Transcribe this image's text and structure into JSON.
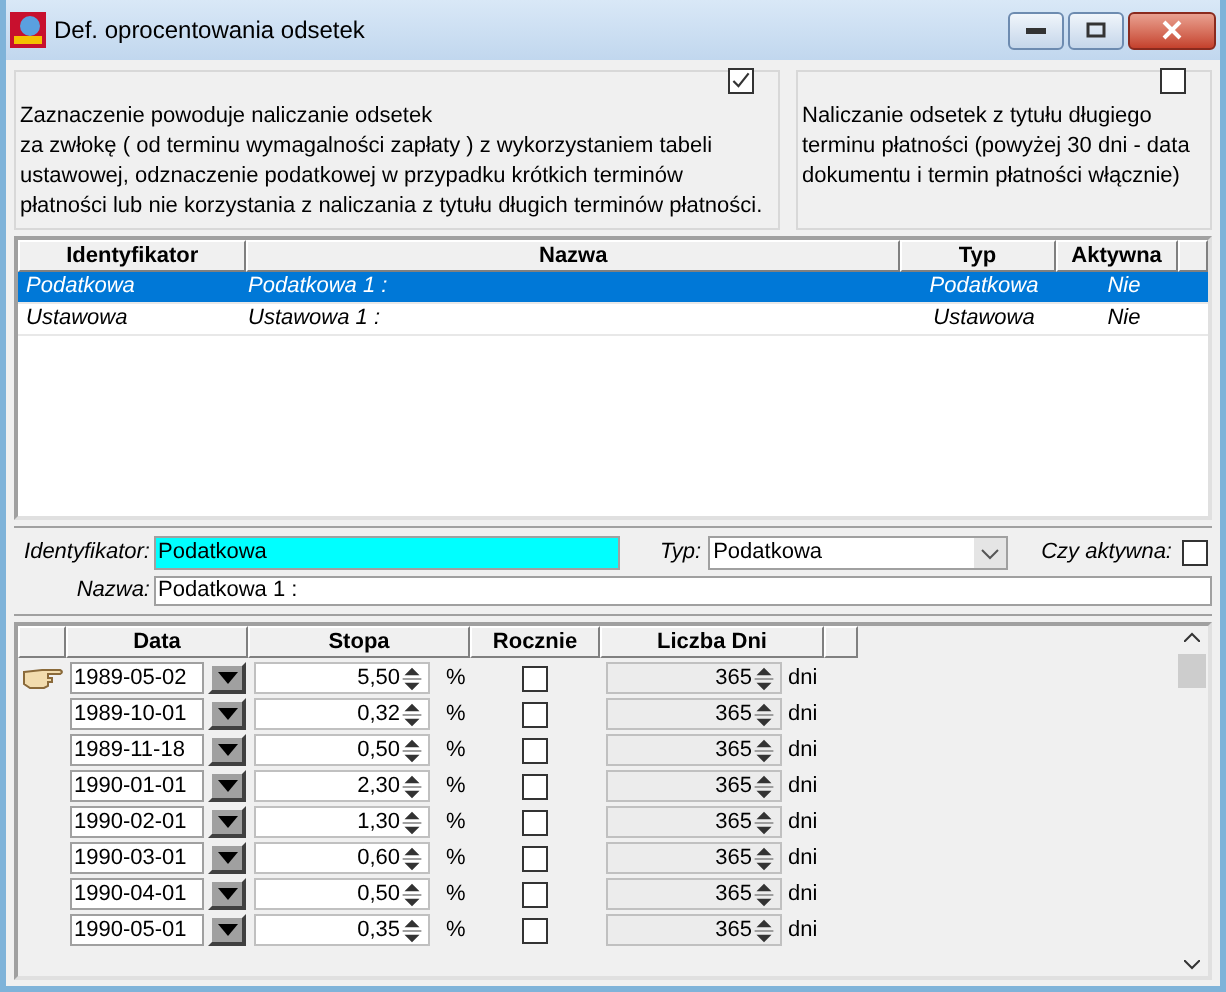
{
  "window": {
    "title": "Def. oprocentowania odsetek"
  },
  "panels": [
    {
      "checked": true,
      "lines": [
        "Zaznaczenie powoduje naliczanie odsetek",
        "za zwłokę ( od terminu wymagalności zapłaty ) z wykorzystaniem tabeli",
        "ustawowej, odznaczenie podatkowej w przypadku krótkich terminów",
        "płatności lub nie korzystania z naliczania z tytułu długich terminów płatności."
      ]
    },
    {
      "checked": false,
      "lines": [
        "Naliczanie odsetek z tytułu długiego",
        "terminu płatności (powyżej 30 dni - data",
        "dokumentu i termin płatności włącznie)"
      ]
    }
  ],
  "table": {
    "columns": [
      "Identyfikator",
      "Nazwa",
      "Typ",
      "Aktywna"
    ],
    "rows": [
      {
        "selected": true,
        "cells": [
          "Podatkowa",
          "Podatkowa 1 :",
          "Podatkowa",
          "Nie"
        ]
      },
      {
        "selected": false,
        "cells": [
          "Ustawowa",
          "Ustawowa 1 :",
          "Ustawowa",
          "Nie"
        ]
      }
    ]
  },
  "form": {
    "id_label": "Identyfikator:",
    "id_value": "Podatkowa",
    "type_label": "Typ:",
    "type_value": "Podatkowa",
    "active_label": "Czy aktywna:",
    "active_checked": false,
    "name_label": "Nazwa:",
    "name_value": "Podatkowa 1 :"
  },
  "rates": {
    "columns": [
      "Data",
      "Stopa",
      "Rocznie",
      "Liczba Dni"
    ],
    "rows": [
      {
        "current": true,
        "date": "1989-05-02",
        "rate": "5,50",
        "rate_unit": "%",
        "yearly": false,
        "days": "365",
        "days_unit": "dni"
      },
      {
        "current": false,
        "date": "1989-10-01",
        "rate": "0,32",
        "rate_unit": "%",
        "yearly": false,
        "days": "365",
        "days_unit": "dni"
      },
      {
        "current": false,
        "date": "1989-11-18",
        "rate": "0,50",
        "rate_unit": "%",
        "yearly": false,
        "days": "365",
        "days_unit": "dni"
      },
      {
        "current": false,
        "date": "1990-01-01",
        "rate": "2,30",
        "rate_unit": "%",
        "yearly": false,
        "days": "365",
        "days_unit": "dni"
      },
      {
        "current": false,
        "date": "1990-02-01",
        "rate": "1,30",
        "rate_unit": "%",
        "yearly": false,
        "days": "365",
        "days_unit": "dni"
      },
      {
        "current": false,
        "date": "1990-03-01",
        "rate": "0,60",
        "rate_unit": "%",
        "yearly": false,
        "days": "365",
        "days_unit": "dni"
      },
      {
        "current": false,
        "date": "1990-04-01",
        "rate": "0,50",
        "rate_unit": "%",
        "yearly": false,
        "days": "365",
        "days_unit": "dni"
      },
      {
        "current": false,
        "date": "1990-05-01",
        "rate": "0,35",
        "rate_unit": "%",
        "yearly": false,
        "days": "365",
        "days_unit": "dni"
      }
    ]
  }
}
